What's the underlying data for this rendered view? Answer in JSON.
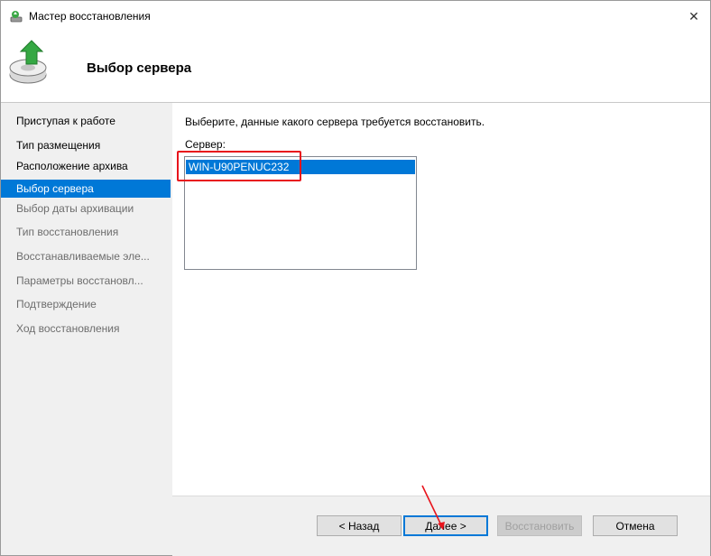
{
  "window": {
    "title": "Мастер восстановления",
    "close_glyph": "✕"
  },
  "header": {
    "page_title": "Выбор сервера",
    "icon": "backup-restore-icon"
  },
  "sidebar": {
    "items": [
      {
        "label": "Приступая к работе",
        "state": "done"
      },
      {
        "label": "Тип размещения",
        "state": "done"
      },
      {
        "label": "Расположение архива",
        "state": "done"
      },
      {
        "label": "Выбор сервера",
        "state": "active"
      },
      {
        "label": "Выбор даты архивации",
        "state": "future"
      },
      {
        "label": "Тип восстановления",
        "state": "future"
      },
      {
        "label": "Восстанавливаемые эле...",
        "state": "future"
      },
      {
        "label": "Параметры восстановл...",
        "state": "future"
      },
      {
        "label": "Подтверждение",
        "state": "future"
      },
      {
        "label": "Ход восстановления",
        "state": "future"
      }
    ]
  },
  "main": {
    "instruction": "Выберите, данные какого сервера требуется восстановить.",
    "server_label": "Сервер:",
    "servers": [
      {
        "name": "WIN-U90PENUC232",
        "selected": true
      }
    ]
  },
  "footer": {
    "back_label": "< Назад",
    "next_label": "Далее >",
    "recover_label": "Восстановить",
    "cancel_label": "Отмена"
  },
  "colors": {
    "accent": "#0078d7",
    "annotation": "#e8141c"
  }
}
